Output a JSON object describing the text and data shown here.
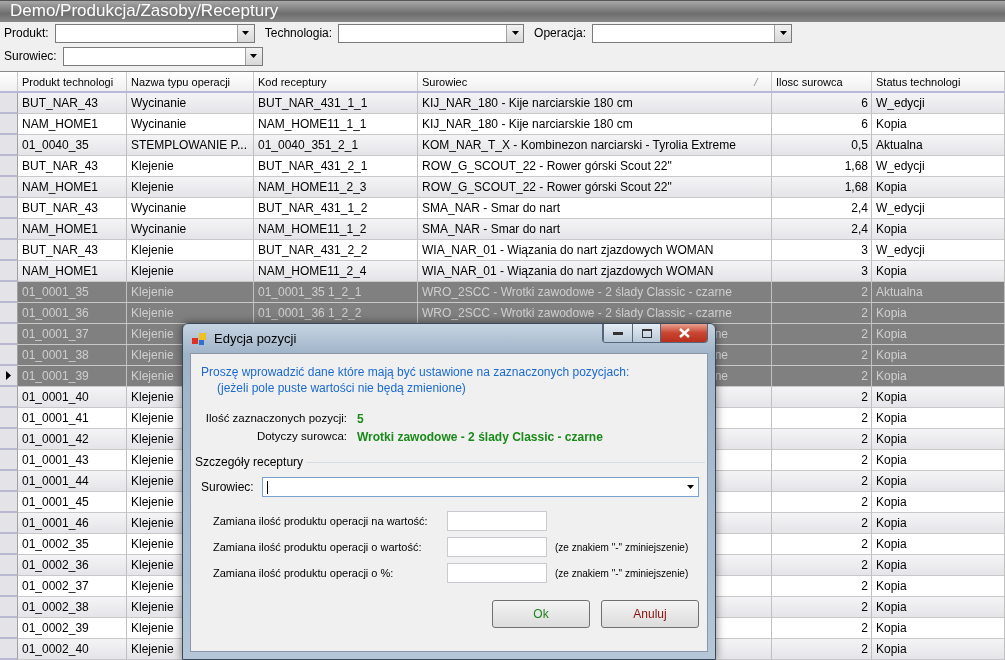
{
  "window": {
    "title": "Demo/Produkcja/Zasoby/Receptury"
  },
  "filters": [
    [
      {
        "label": "Produkt:"
      },
      {
        "label": "Technologia:"
      },
      {
        "label": "Operacja:"
      }
    ],
    [
      {
        "label": "Surowiec:"
      }
    ]
  ],
  "table": {
    "columns": [
      "Produkt technologi",
      "Nazwa typu operacji",
      "Kod receptury",
      "Surowiec",
      "Ilosc surowca",
      "Status technologi"
    ],
    "rows": [
      {
        "produkt": "BUT_NAR_43",
        "operacja": "Wycinanie",
        "kod": "BUT_NAR_431_1_1",
        "surowiec": "KIJ_NAR_180 - Kije narciarskie 180 cm",
        "ilosc": "6",
        "status": "W_edycji",
        "selected": false,
        "current": false
      },
      {
        "produkt": "NAM_HOME1",
        "operacja": "Wycinanie",
        "kod": "NAM_HOME11_1_1",
        "surowiec": "KIJ_NAR_180 - Kije narciarskie 180 cm",
        "ilosc": "6",
        "status": "Kopia",
        "selected": false,
        "current": false
      },
      {
        "produkt": "01_0040_35",
        "operacja": "STEMPLOWANIE P...",
        "kod": "01_0040_351_2_1",
        "surowiec": "KOM_NAR_T_X - Kombinezon narciarski - Tyrolia Extreme",
        "ilosc": "0,5",
        "status": "Aktualna",
        "selected": false,
        "current": false
      },
      {
        "produkt": "BUT_NAR_43",
        "operacja": "Klejenie",
        "kod": "BUT_NAR_431_2_1",
        "surowiec": "ROW_G_SCOUT_22 - Rower górski Scout 22\"",
        "ilosc": "1,68",
        "status": "W_edycji",
        "selected": false,
        "current": false
      },
      {
        "produkt": "NAM_HOME1",
        "operacja": "Klejenie",
        "kod": "NAM_HOME11_2_3",
        "surowiec": "ROW_G_SCOUT_22 - Rower górski Scout 22\"",
        "ilosc": "1,68",
        "status": "Kopia",
        "selected": false,
        "current": false
      },
      {
        "produkt": "BUT_NAR_43",
        "operacja": "Wycinanie",
        "kod": "BUT_NAR_431_1_2",
        "surowiec": "SMA_NAR - Smar do nart",
        "ilosc": "2,4",
        "status": "W_edycji",
        "selected": false,
        "current": false
      },
      {
        "produkt": "NAM_HOME1",
        "operacja": "Wycinanie",
        "kod": "NAM_HOME11_1_2",
        "surowiec": "SMA_NAR - Smar do nart",
        "ilosc": "2,4",
        "status": "Kopia",
        "selected": false,
        "current": false
      },
      {
        "produkt": "BUT_NAR_43",
        "operacja": "Klejenie",
        "kod": "BUT_NAR_431_2_2",
        "surowiec": "WIA_NAR_01 - Wiązania do nart zjazdowych WOMAN",
        "ilosc": "3",
        "status": "W_edycji",
        "selected": false,
        "current": false
      },
      {
        "produkt": "NAM_HOME1",
        "operacja": "Klejenie",
        "kod": "NAM_HOME11_2_4",
        "surowiec": "WIA_NAR_01 - Wiązania do nart zjazdowych WOMAN",
        "ilosc": "3",
        "status": "Kopia",
        "selected": false,
        "current": false
      },
      {
        "produkt": "01_0001_35",
        "operacja": "Klejenie",
        "kod": "01_0001_35 1_2_1",
        "surowiec": "WRO_2SCC - Wrotki zawodowe - 2 ślady Classic - czarne",
        "ilosc": "2",
        "status": "Aktualna",
        "selected": true,
        "current": false
      },
      {
        "produkt": "01_0001_36",
        "operacja": "Klejenie",
        "kod": "01_0001_36 1_2_2",
        "surowiec": "WRO_2SCC - Wrotki zawodowe - 2 ślady Classic - czarne",
        "ilosc": "2",
        "status": "Kopia",
        "selected": true,
        "current": false
      },
      {
        "produkt": "01_0001_37",
        "operacja": "Klejenie",
        "surowiec_tail": "ne",
        "ilosc": "2",
        "status": "Kopia",
        "selected": true,
        "current": false
      },
      {
        "produkt": "01_0001_38",
        "operacja": "Klejenie",
        "surowiec_tail": "ne",
        "ilosc": "2",
        "status": "Kopia",
        "selected": true,
        "current": false
      },
      {
        "produkt": "01_0001_39",
        "operacja": "Klejenie",
        "surowiec_tail": "ne",
        "ilosc": "2",
        "status": "Kopia",
        "selected": true,
        "current": true
      },
      {
        "produkt": "01_0001_40",
        "operacja": "Klejenie",
        "ilosc": "2",
        "status": "Kopia",
        "selected": false,
        "current": false
      },
      {
        "produkt": "01_0001_41",
        "operacja": "Klejenie",
        "ilosc": "2",
        "status": "Kopia",
        "selected": false,
        "current": false
      },
      {
        "produkt": "01_0001_42",
        "operacja": "Klejenie",
        "ilosc": "2",
        "status": "Kopia",
        "selected": false,
        "current": false
      },
      {
        "produkt": "01_0001_43",
        "operacja": "Klejenie",
        "ilosc": "2",
        "status": "Kopia",
        "selected": false,
        "current": false
      },
      {
        "produkt": "01_0001_44",
        "operacja": "Klejenie",
        "ilosc": "2",
        "status": "Kopia",
        "selected": false,
        "current": false
      },
      {
        "produkt": "01_0001_45",
        "operacja": "Klejenie",
        "ilosc": "2",
        "status": "Kopia",
        "selected": false,
        "current": false
      },
      {
        "produkt": "01_0001_46",
        "operacja": "Klejenie",
        "ilosc": "2",
        "status": "Kopia",
        "selected": false,
        "current": false
      },
      {
        "produkt": "01_0002_35",
        "operacja": "Klejenie",
        "ilosc": "2",
        "status": "Kopia",
        "selected": false,
        "current": false
      },
      {
        "produkt": "01_0002_36",
        "operacja": "Klejenie",
        "ilosc": "2",
        "status": "Kopia",
        "selected": false,
        "current": false
      },
      {
        "produkt": "01_0002_37",
        "operacja": "Klejenie",
        "ilosc": "2",
        "status": "Kopia",
        "selected": false,
        "current": false
      },
      {
        "produkt": "01_0002_38",
        "operacja": "Klejenie",
        "ilosc": "2",
        "status": "Kopia",
        "selected": false,
        "current": false
      },
      {
        "produkt": "01_0002_39",
        "operacja": "Klejenie",
        "ilosc": "2",
        "status": "Kopia",
        "selected": false,
        "current": false
      },
      {
        "produkt": "01_0002_40",
        "operacja": "Klejenie",
        "ilosc": "2",
        "status": "Kopia",
        "selected": false,
        "current": false
      }
    ]
  },
  "dialog": {
    "title": "Edycja pozycji",
    "intro": [
      "Proszę wprowadzić dane które mają być ustawione na zaznaczonych pozycjach:",
      "(jeżeli pole puste wartości nie będą zmienione)"
    ],
    "info": [
      {
        "label": "Ilość zaznaczonych pozycji:",
        "value": "5"
      },
      {
        "label": "Dotyczy surowca:",
        "value": "Wrotki zawodowe - 2 ślady Classic - czarne"
      }
    ],
    "group": {
      "title": "Szczegóły receptury",
      "surowiec_label": "Surowiec:",
      "fields": [
        {
          "label": "Zamiana ilość produktu operacji na wartość:"
        },
        {
          "label": "Zamiana ilość produktu operacji o wartość:",
          "note": "(ze znakiem \"-\" zminiejszenie)"
        },
        {
          "label": "Zamiana ilość produktu operacji o %:",
          "note": "(ze znakiem \"-\" zminiejszenie)"
        }
      ]
    },
    "buttons": [
      {
        "label": "Ok",
        "kind": "ok"
      },
      {
        "label": "Anuluj",
        "kind": "cancel"
      }
    ]
  }
}
